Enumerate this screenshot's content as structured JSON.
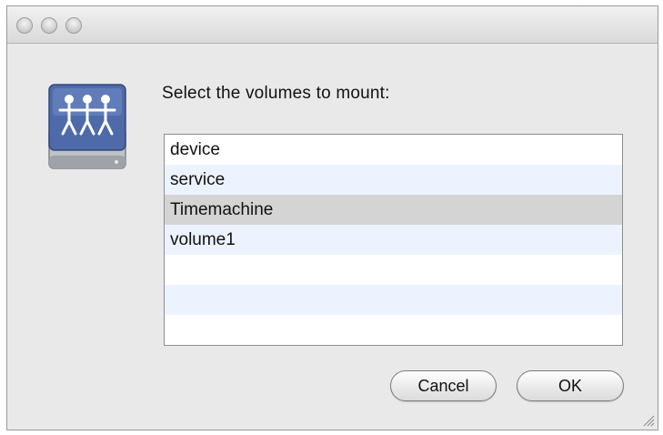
{
  "dialog": {
    "prompt": "Select the volumes to mount:",
    "icon": "shared-network-volume-icon"
  },
  "volumes": [
    {
      "label": "device",
      "selected": false
    },
    {
      "label": "service",
      "selected": false
    },
    {
      "label": "Timemachine",
      "selected": true
    },
    {
      "label": "volume1",
      "selected": false
    },
    {
      "label": "",
      "selected": false
    },
    {
      "label": "",
      "selected": false
    },
    {
      "label": "",
      "selected": false
    }
  ],
  "buttons": {
    "cancel_label": "Cancel",
    "ok_label": "OK"
  },
  "colors": {
    "window_bg": "#e9e9e9",
    "row_alt": "#edf3fe",
    "row_selected": "#d4d4d4",
    "icon_blue": "#4f6aa8"
  }
}
